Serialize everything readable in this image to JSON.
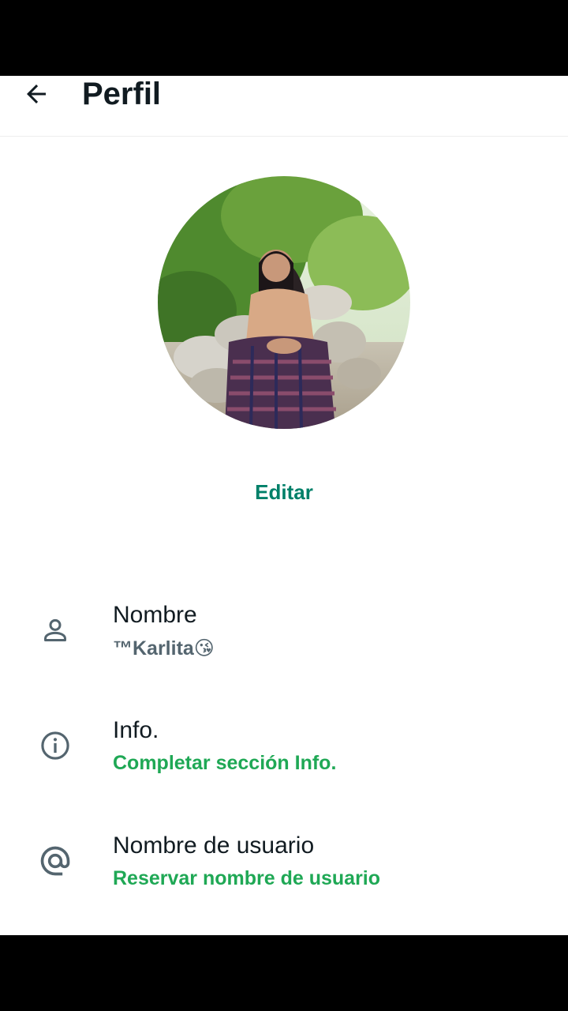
{
  "header": {
    "back_label": "←",
    "title": "Perfil"
  },
  "profile": {
    "photo_alt": "Foto de perfil",
    "edit_label": "Editar"
  },
  "rows": [
    {
      "icon": "person-icon",
      "label": "Nombre",
      "value": "™Karlita😘"
    },
    {
      "icon": "info-icon",
      "label": "Info.",
      "value": "Completar sección Info."
    },
    {
      "icon": "at-sign-icon",
      "label": "Nombre de usuario",
      "value": "Reservar nombre de usuario"
    }
  ],
  "colors": {
    "accent_green": "#008069",
    "link_green": "#1fa855",
    "text_primary": "#111b21",
    "icon_gray": "#54656f"
  }
}
